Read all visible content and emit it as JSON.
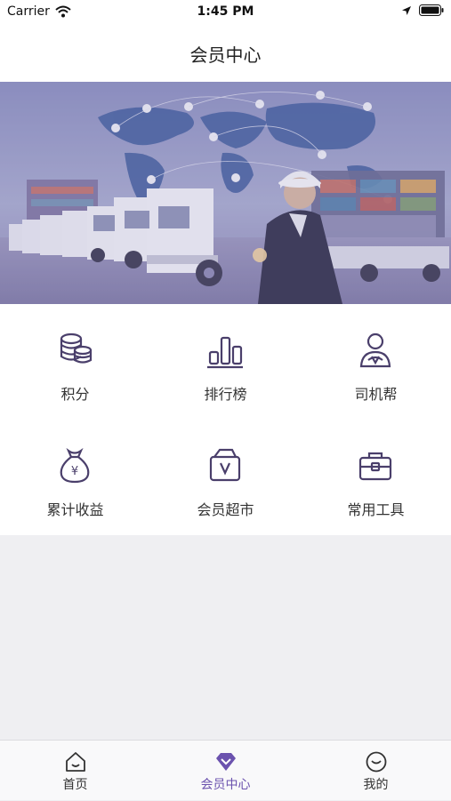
{
  "status_bar": {
    "carrier": "Carrier",
    "time": "1:45 PM"
  },
  "nav": {
    "title": "会员中心"
  },
  "features": [
    {
      "label": "积分",
      "icon": "coins-stack-icon"
    },
    {
      "label": "排行榜",
      "icon": "ranking-bars-icon"
    },
    {
      "label": "司机帮",
      "icon": "driver-user-icon"
    },
    {
      "label": "累计收益",
      "icon": "money-bag-icon"
    },
    {
      "label": "会员超市",
      "icon": "shopping-bag-icon"
    },
    {
      "label": "常用工具",
      "icon": "toolbox-icon"
    }
  ],
  "tabs": [
    {
      "label": "首页",
      "icon": "home-icon"
    },
    {
      "label": "会员中心",
      "icon": "diamond-icon"
    },
    {
      "label": "我的",
      "icon": "smiley-icon"
    }
  ],
  "active_tab": 1,
  "colors": {
    "accent": "#6b52ae",
    "icon_stroke": "#4a3f6b",
    "background": "#efeff2"
  }
}
